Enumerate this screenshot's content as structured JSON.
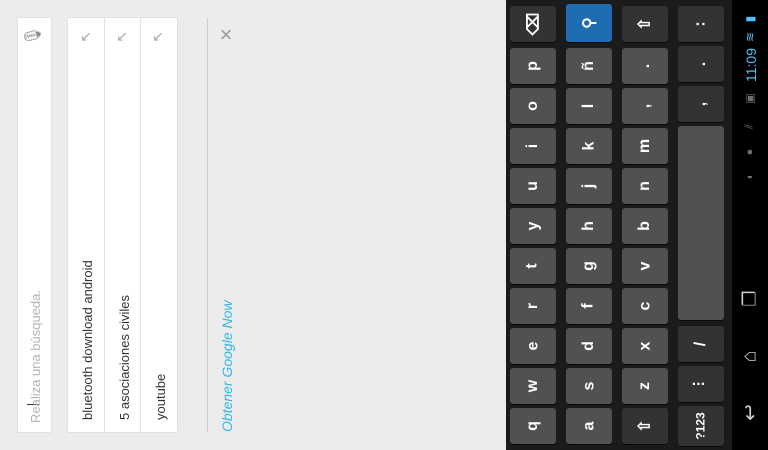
{
  "search": {
    "placeholder": "Realiza una búsqueda.",
    "mic_icon": "mic-icon"
  },
  "suggestions": [
    {
      "text": "bluetooth download android",
      "icon": "arrow-up-left-icon"
    },
    {
      "text": "5 asociaciones civiles",
      "icon": "arrow-up-left-icon"
    },
    {
      "text": "youtube",
      "icon": "arrow-up-left-icon"
    }
  ],
  "google_now": {
    "link_text": "Obtener Google Now",
    "close_icon": "close-icon",
    "link_color": "#33b5e5"
  },
  "keyboard": {
    "row1": [
      "q",
      "w",
      "e",
      "r",
      "t",
      "y",
      "u",
      "i",
      "o",
      "p"
    ],
    "row2": [
      "a",
      "s",
      "d",
      "f",
      "g",
      "h",
      "j",
      "k",
      "l",
      "ñ"
    ],
    "row3": [
      "z",
      "x",
      "c",
      "v",
      "b",
      "n",
      "m",
      ",",
      "."
    ],
    "shift_label": "⇧",
    "symbols_label": "?123",
    "settings_label": "⫶",
    "mic_key_label": "/",
    "comma_label": ",",
    "dot_label": ".",
    "colon_label": ":",
    "delete_icon": "backspace-icon",
    "search_icon": "search-icon",
    "accent_color": "#1f6db0"
  },
  "status_bar": {
    "time": "11:09",
    "wifi_icon": "wifi-icon",
    "battery_icon": "battery-icon"
  },
  "nav_bar": {
    "back_icon": "back-icon",
    "home_icon": "home-icon",
    "recents_icon": "recent-apps-icon"
  }
}
